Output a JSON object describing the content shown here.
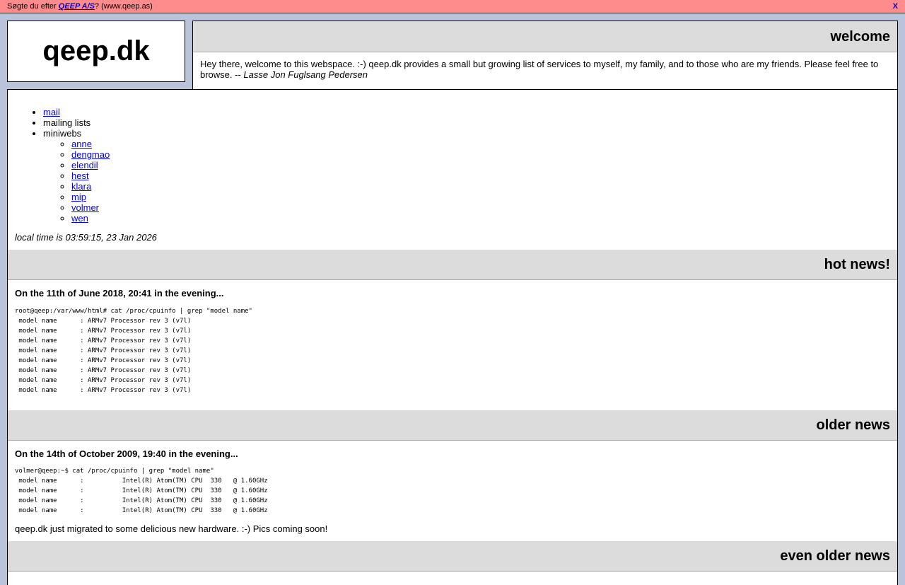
{
  "banner": {
    "prefix": "Søgte du efter ",
    "link": "QEEP A/S",
    "suffix": "? (www.qeep.as)",
    "close": "X"
  },
  "logo": "qeep.dk",
  "welcome": {
    "title": "welcome",
    "text": "Hey there, welcome to this webspace. :-) qeep.dk provides a small but growing list of services to myself, my family, and to those who are my friends. Please feel free to browse. -- ",
    "author": "Lasse Jon Fuglsang Pedersen"
  },
  "nav": {
    "mail": "mail",
    "mailing_lists": "mailing lists",
    "miniwebs": "miniwebs",
    "sub": [
      "anne",
      "dengmao",
      "elendil",
      "hest",
      "klara",
      "mip",
      "volmer",
      "wen"
    ]
  },
  "localtime": "local time is 03:59:15, 23 Jan 2026",
  "hot_news": {
    "title": "hot news!",
    "entry_title": "On the 11th of June 2018, 20:41 in the evening...",
    "code": "root@qeep:/var/www/html# cat /proc/cpuinfo | grep \"model name\"\n model name      : ARMv7 Processor rev 3 (v7l)\n model name      : ARMv7 Processor rev 3 (v7l)\n model name      : ARMv7 Processor rev 3 (v7l)\n model name      : ARMv7 Processor rev 3 (v7l)\n model name      : ARMv7 Processor rev 3 (v7l)\n model name      : ARMv7 Processor rev 3 (v7l)\n model name      : ARMv7 Processor rev 3 (v7l)\n model name      : ARMv7 Processor rev 3 (v7l)"
  },
  "older_news": {
    "title": "older news",
    "entry_title": "On the 14th of October 2009, 19:40 in the evening...",
    "code": "volmer@qeep:~$ cat /proc/cpuinfo | grep \"model name\"\n model name      :          Intel(R) Atom(TM) CPU  330   @ 1.60GHz\n model name      :          Intel(R) Atom(TM) CPU  330   @ 1.60GHz\n model name      :          Intel(R) Atom(TM) CPU  330   @ 1.60GHz\n model name      :          Intel(R) Atom(TM) CPU  330   @ 1.60GHz",
    "note": "qeep.dk just migrated to some delicious new hardware. :-) Pics coming soon!"
  },
  "even_older_news": {
    "title": "even older news"
  }
}
